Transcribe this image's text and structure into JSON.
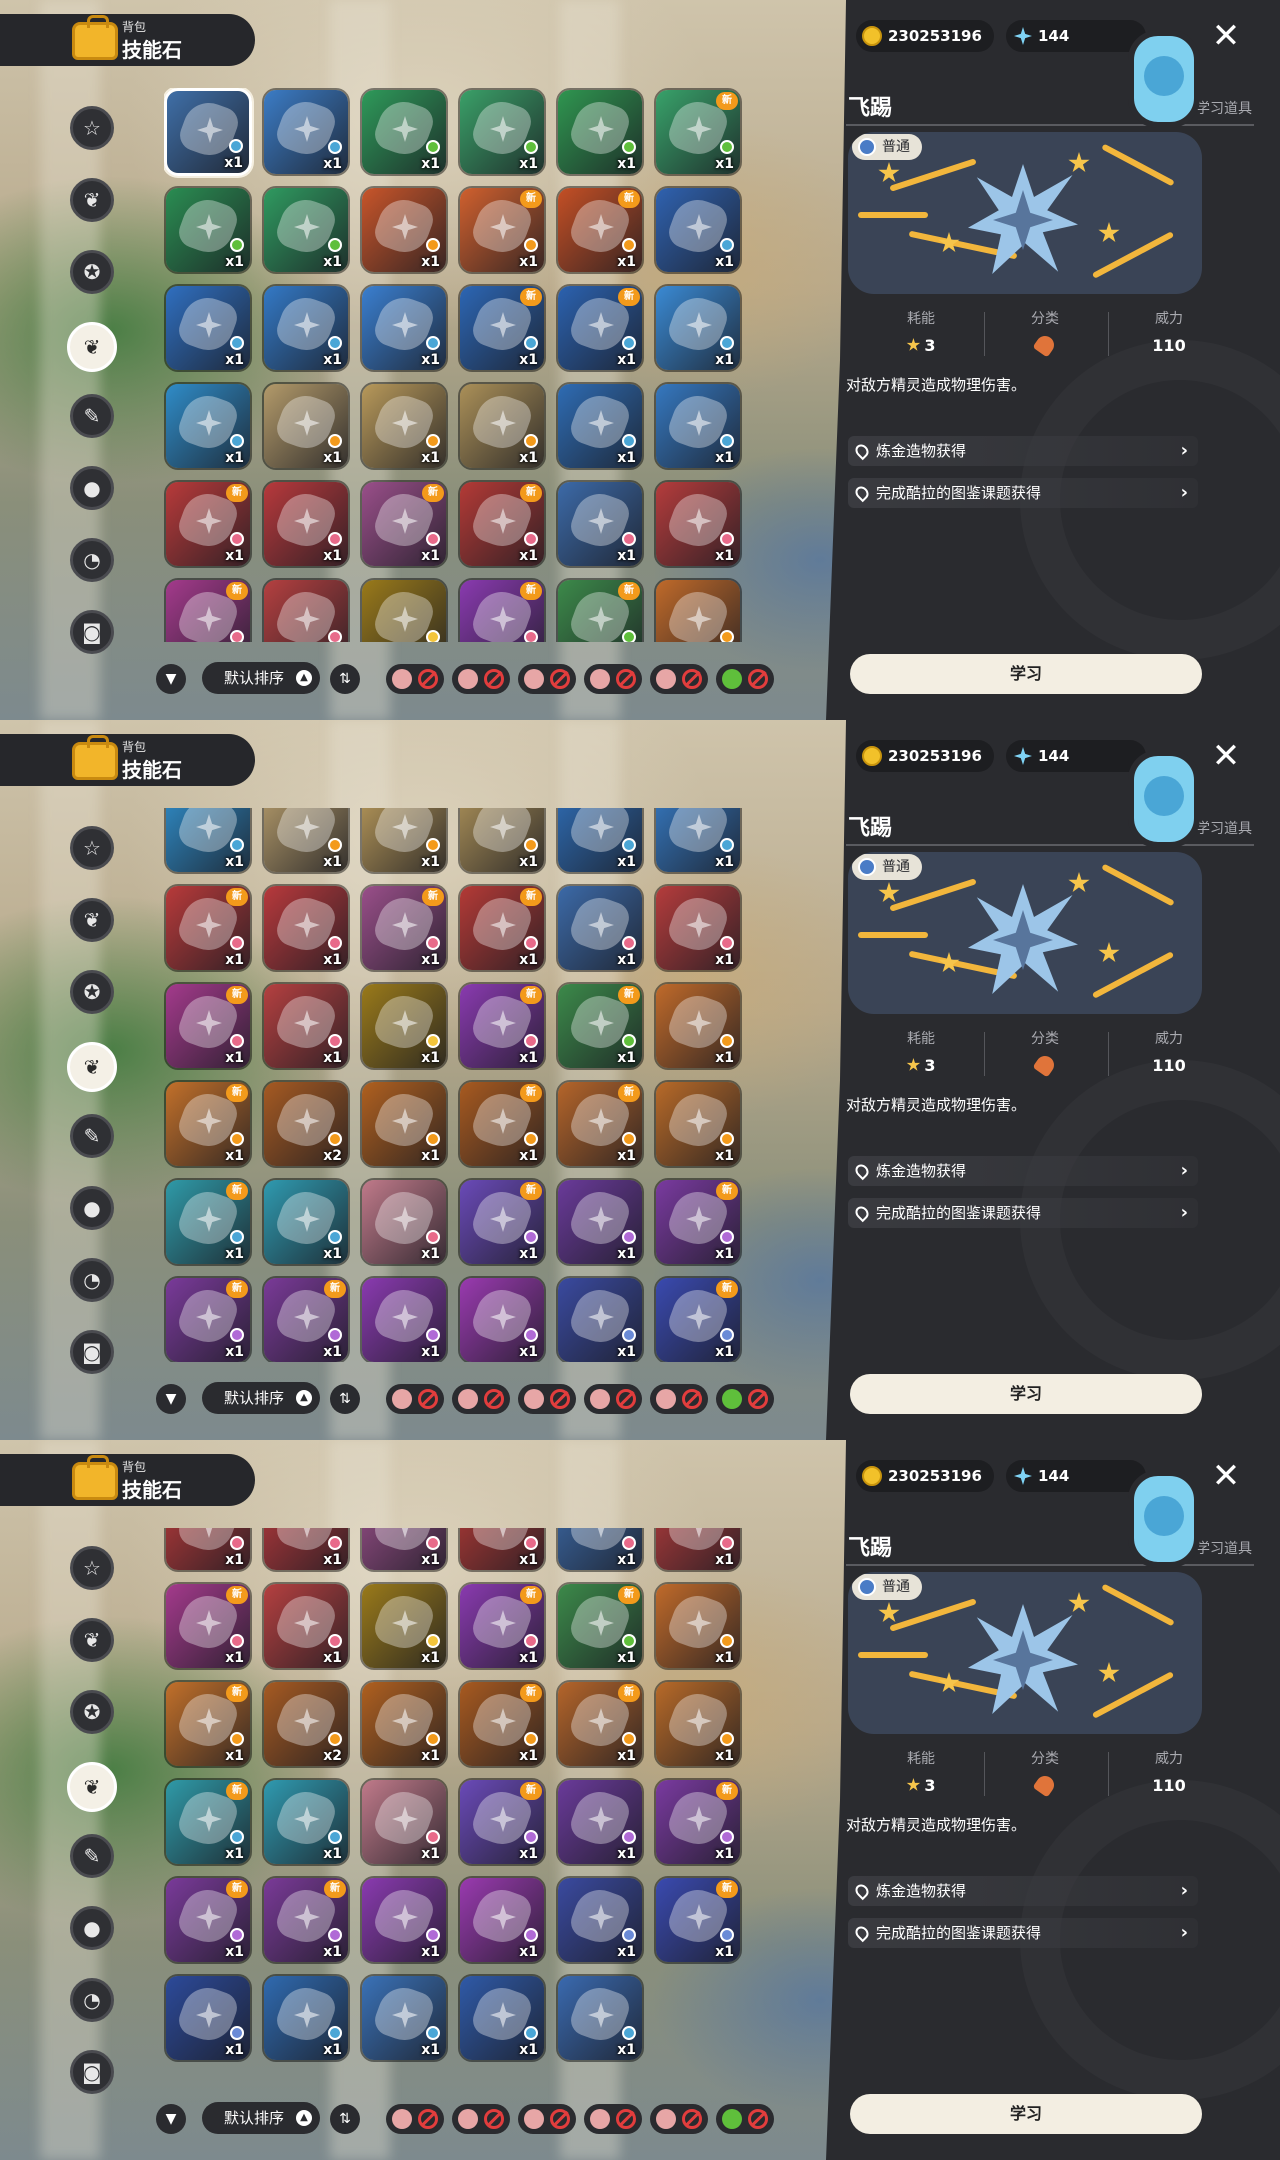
{
  "header": {
    "category": "背包",
    "title": "技能石"
  },
  "side_categories": [
    {
      "icon": "star-icon"
    },
    {
      "icon": "leaf-icon"
    },
    {
      "icon": "compass-icon"
    },
    {
      "icon": "skill-stone-icon"
    },
    {
      "icon": "scroll-icon"
    },
    {
      "icon": "ball-icon"
    },
    {
      "icon": "acorn-icon"
    },
    {
      "icon": "chest-icon"
    }
  ],
  "filter_bar": {
    "sort_label": "默认排序",
    "chips": [
      {
        "icon": "pet-face-icon",
        "disabled": true
      },
      {
        "icon": "pet-face-icon",
        "disabled": true
      },
      {
        "icon": "pet-face-icon",
        "disabled": true
      },
      {
        "icon": "pet-face-icon",
        "disabled": true
      },
      {
        "icon": "pet-face-icon",
        "disabled": true
      },
      {
        "icon": "green-pet-icon",
        "disabled": true
      }
    ]
  },
  "currency": {
    "coins": "230253196",
    "gems": "144"
  },
  "detail": {
    "name": "飞踢",
    "item_type": "精灵技能学习道具",
    "rarity": "普通",
    "cost_label": "耗能",
    "cost_value": "3",
    "category_label": "分类",
    "power_label": "威力",
    "power_value": "110",
    "description": "对敌方精灵造成物理伤害。",
    "sources": [
      "炼金造物获得",
      "完成酷拉的图鉴课题获得"
    ],
    "learn_button": "学习"
  },
  "colors": {
    "accent": "#f39a1b",
    "panel": "#2a2b2f",
    "button": "#f3eee2"
  },
  "panels": [
    {
      "active_category": 3,
      "rows": [
        [
          {
            "color": "#3f6fa8",
            "count": "x1",
            "gem": "#4aa6d6",
            "selected": true
          },
          {
            "color": "#3b7cc6",
            "count": "x1",
            "gem": "#4aa6d6"
          },
          {
            "color": "#2e9a5a",
            "count": "x1",
            "gem": "#5fbf3b"
          },
          {
            "color": "#3aa068",
            "count": "x1",
            "gem": "#5fbf3b"
          },
          {
            "color": "#2f9650",
            "count": "x1",
            "gem": "#5fbf3b"
          },
          {
            "color": "#38a26a",
            "count": "x1",
            "gem": "#5fbf3b",
            "new": true
          }
        ],
        [
          {
            "color": "#2a8d52",
            "count": "x1",
            "gem": "#5fbf3b"
          },
          {
            "color": "#2f9a60",
            "count": "x1",
            "gem": "#5fbf3b"
          },
          {
            "color": "#c8552a",
            "count": "x1",
            "gem": "#f39a1b"
          },
          {
            "color": "#d0602e",
            "count": "x1",
            "gem": "#f39a1b",
            "new": true
          },
          {
            "color": "#c44f25",
            "count": "x1",
            "gem": "#f39a1b",
            "new": true
          },
          {
            "color": "#2f62b0",
            "count": "x1",
            "gem": "#4aa6d6"
          }
        ],
        [
          {
            "color": "#2f6fc0",
            "count": "x1",
            "gem": "#4aa6d6"
          },
          {
            "color": "#3379c6",
            "count": "x1",
            "gem": "#4aa6d6"
          },
          {
            "color": "#3a7fd0",
            "count": "x1",
            "gem": "#4aa6d6"
          },
          {
            "color": "#2c66b4",
            "count": "x1",
            "gem": "#4aa6d6",
            "new": true
          },
          {
            "color": "#2b62b0",
            "count": "x1",
            "gem": "#4aa6d6",
            "new": true
          },
          {
            "color": "#3a8ad4",
            "count": "x1",
            "gem": "#4aa6d6"
          }
        ],
        [
          {
            "color": "#2f8cc8",
            "count": "x1",
            "gem": "#4aa6d6"
          },
          {
            "color": "#b39a6a",
            "count": "x1",
            "gem": "#f39a1b"
          },
          {
            "color": "#b8995a",
            "count": "x1",
            "gem": "#f39a1b"
          },
          {
            "color": "#ab9058",
            "count": "x1",
            "gem": "#f39a1b"
          },
          {
            "color": "#2e6cb4",
            "count": "x1",
            "gem": "#4aa6d6"
          },
          {
            "color": "#3578c0",
            "count": "x1",
            "gem": "#4aa6d6"
          }
        ],
        [
          {
            "color": "#b83a3a",
            "count": "x1",
            "gem": "#e86a8a",
            "new": true
          },
          {
            "color": "#b8393c",
            "count": "x1",
            "gem": "#e86a8a"
          },
          {
            "color": "#9a4f8a",
            "count": "x1",
            "gem": "#e86a8a",
            "new": true
          },
          {
            "color": "#b43a36",
            "count": "x1",
            "gem": "#e86a8a",
            "new": true
          },
          {
            "color": "#3c6aa8",
            "count": "x1",
            "gem": "#e86a8a"
          },
          {
            "color": "#b53c3c",
            "count": "x1",
            "gem": "#e86a8a"
          }
        ],
        [
          {
            "color": "#a43a8c",
            "count": "x1",
            "gem": "#e86a8a",
            "new": true
          },
          {
            "color": "#b54040",
            "count": "x1",
            "gem": "#e86a8a"
          },
          {
            "color": "#9a7a1a",
            "count": "x1",
            "gem": "#f3c53b"
          },
          {
            "color": "#8a3ab0",
            "count": "x1",
            "gem": "#e86a8a",
            "new": true
          },
          {
            "color": "#3c8a4a",
            "count": "x1",
            "gem": "#5fbf3b",
            "new": true
          },
          {
            "color": "#c06a2a",
            "count": "x1",
            "gem": "#f39a1b"
          }
        ]
      ]
    },
    {
      "active_category": 3,
      "rows": [
        [
          {
            "color": "#2f8cc8",
            "count": "x1",
            "gem": "#4aa6d6"
          },
          {
            "color": "#b39a6a",
            "count": "x1",
            "gem": "#f39a1b"
          },
          {
            "color": "#b8995a",
            "count": "x1",
            "gem": "#f39a1b"
          },
          {
            "color": "#ab9058",
            "count": "x1",
            "gem": "#f39a1b"
          },
          {
            "color": "#2e6cb4",
            "count": "x1",
            "gem": "#4aa6d6"
          },
          {
            "color": "#3578c0",
            "count": "x1",
            "gem": "#4aa6d6"
          }
        ],
        [
          {
            "color": "#b83a3a",
            "count": "x1",
            "gem": "#e86a8a",
            "new": true
          },
          {
            "color": "#b8393c",
            "count": "x1",
            "gem": "#e86a8a"
          },
          {
            "color": "#9a4f8a",
            "count": "x1",
            "gem": "#e86a8a",
            "new": true
          },
          {
            "color": "#b43a36",
            "count": "x1",
            "gem": "#e86a8a",
            "new": true
          },
          {
            "color": "#3c6aa8",
            "count": "x1",
            "gem": "#e86a8a"
          },
          {
            "color": "#b53c3c",
            "count": "x1",
            "gem": "#e86a8a"
          }
        ],
        [
          {
            "color": "#a43a8c",
            "count": "x1",
            "gem": "#e86a8a",
            "new": true
          },
          {
            "color": "#b54040",
            "count": "x1",
            "gem": "#e86a8a"
          },
          {
            "color": "#9a7a1a",
            "count": "x1",
            "gem": "#f3c53b"
          },
          {
            "color": "#8a3ab0",
            "count": "x1",
            "gem": "#e86a8a",
            "new": true
          },
          {
            "color": "#3c8a4a",
            "count": "x1",
            "gem": "#5fbf3b",
            "new": true
          },
          {
            "color": "#c06a2a",
            "count": "x1",
            "gem": "#f39a1b"
          }
        ],
        [
          {
            "color": "#c2702a",
            "count": "x1",
            "gem": "#f39a1b",
            "new": true
          },
          {
            "color": "#a65a22",
            "count": "x2",
            "gem": "#f39a1b"
          },
          {
            "color": "#b0601f",
            "count": "x1",
            "gem": "#f39a1b"
          },
          {
            "color": "#a85a20",
            "count": "x1",
            "gem": "#f39a1b",
            "new": true
          },
          {
            "color": "#b5652a",
            "count": "x1",
            "gem": "#f39a1b",
            "new": true
          },
          {
            "color": "#b86a28",
            "count": "x1",
            "gem": "#f39a1b"
          }
        ],
        [
          {
            "color": "#2f9aa8",
            "count": "x1",
            "gem": "#4aa6d6",
            "new": true
          },
          {
            "color": "#2f9ab0",
            "count": "x1",
            "gem": "#4aa6d6"
          },
          {
            "color": "#c07a8a",
            "count": "x1",
            "gem": "#e86a8a"
          },
          {
            "color": "#6a4ab8",
            "count": "x1",
            "gem": "#b06ad6",
            "new": true
          },
          {
            "color": "#6a3a9a",
            "count": "x1",
            "gem": "#b06ad6"
          },
          {
            "color": "#7a3aa0",
            "count": "x1",
            "gem": "#b06ad6",
            "new": true
          }
        ],
        [
          {
            "color": "#7a3a9a",
            "count": "x1",
            "gem": "#b06ad6",
            "new": true
          },
          {
            "color": "#7a3a98",
            "count": "x1",
            "gem": "#b06ad6",
            "new": true
          },
          {
            "color": "#8a3ab0",
            "count": "x1",
            "gem": "#b06ad6"
          },
          {
            "color": "#9a3ab0",
            "count": "x1",
            "gem": "#b06ad6"
          },
          {
            "color": "#3a4aa0",
            "count": "x1",
            "gem": "#6a8ad6"
          },
          {
            "color": "#3a4ab0",
            "count": "x1",
            "gem": "#6a8ad6",
            "new": true
          }
        ]
      ]
    },
    {
      "active_category": 3,
      "rows": [
        [
          {
            "color": "#b83a3a",
            "count": "x1",
            "gem": "#e86a8a"
          },
          {
            "color": "#b8393c",
            "count": "x1",
            "gem": "#e86a8a"
          },
          {
            "color": "#9a4f8a",
            "count": "x1",
            "gem": "#e86a8a"
          },
          {
            "color": "#b43a36",
            "count": "x1",
            "gem": "#e86a8a"
          },
          {
            "color": "#3c6aa8",
            "count": "x1",
            "gem": "#e86a8a"
          },
          {
            "color": "#b53c3c",
            "count": "x1",
            "gem": "#e86a8a"
          }
        ],
        [
          {
            "color": "#a43a8c",
            "count": "x1",
            "gem": "#e86a8a",
            "new": true
          },
          {
            "color": "#b54040",
            "count": "x1",
            "gem": "#e86a8a"
          },
          {
            "color": "#9a7a1a",
            "count": "x1",
            "gem": "#f3c53b"
          },
          {
            "color": "#8a3ab0",
            "count": "x1",
            "gem": "#e86a8a",
            "new": true
          },
          {
            "color": "#3c8a4a",
            "count": "x1",
            "gem": "#5fbf3b",
            "new": true
          },
          {
            "color": "#c06a2a",
            "count": "x1",
            "gem": "#f39a1b"
          }
        ],
        [
          {
            "color": "#c2702a",
            "count": "x1",
            "gem": "#f39a1b",
            "new": true
          },
          {
            "color": "#a65a22",
            "count": "x2",
            "gem": "#f39a1b"
          },
          {
            "color": "#b0601f",
            "count": "x1",
            "gem": "#f39a1b"
          },
          {
            "color": "#a85a20",
            "count": "x1",
            "gem": "#f39a1b",
            "new": true
          },
          {
            "color": "#b5652a",
            "count": "x1",
            "gem": "#f39a1b",
            "new": true
          },
          {
            "color": "#b86a28",
            "count": "x1",
            "gem": "#f39a1b"
          }
        ],
        [
          {
            "color": "#2f9aa8",
            "count": "x1",
            "gem": "#4aa6d6",
            "new": true
          },
          {
            "color": "#2f9ab0",
            "count": "x1",
            "gem": "#4aa6d6"
          },
          {
            "color": "#c07a8a",
            "count": "x1",
            "gem": "#e86a8a"
          },
          {
            "color": "#6a4ab8",
            "count": "x1",
            "gem": "#b06ad6",
            "new": true
          },
          {
            "color": "#6a3a9a",
            "count": "x1",
            "gem": "#b06ad6"
          },
          {
            "color": "#7a3aa0",
            "count": "x1",
            "gem": "#b06ad6",
            "new": true
          }
        ],
        [
          {
            "color": "#7a3a9a",
            "count": "x1",
            "gem": "#b06ad6",
            "new": true
          },
          {
            "color": "#7a3a98",
            "count": "x1",
            "gem": "#b06ad6",
            "new": true
          },
          {
            "color": "#8a3ab0",
            "count": "x1",
            "gem": "#b06ad6"
          },
          {
            "color": "#9a3ab0",
            "count": "x1",
            "gem": "#b06ad6"
          },
          {
            "color": "#3a4aa0",
            "count": "x1",
            "gem": "#6a8ad6"
          },
          {
            "color": "#3a4ab0",
            "count": "x1",
            "gem": "#6a8ad6",
            "new": true
          }
        ],
        [
          {
            "color": "#2c4a9a",
            "count": "x1",
            "gem": "#6a8ad6"
          },
          {
            "color": "#2f6ab0",
            "count": "x1",
            "gem": "#4aa6d6"
          },
          {
            "color": "#3a72b8",
            "count": "x1",
            "gem": "#4aa6d6"
          },
          {
            "color": "#2f5aa8",
            "count": "x1",
            "gem": "#4aa6d6"
          },
          {
            "color": "#3a6ab0",
            "count": "x1",
            "gem": "#4aa6d6"
          }
        ]
      ]
    }
  ]
}
